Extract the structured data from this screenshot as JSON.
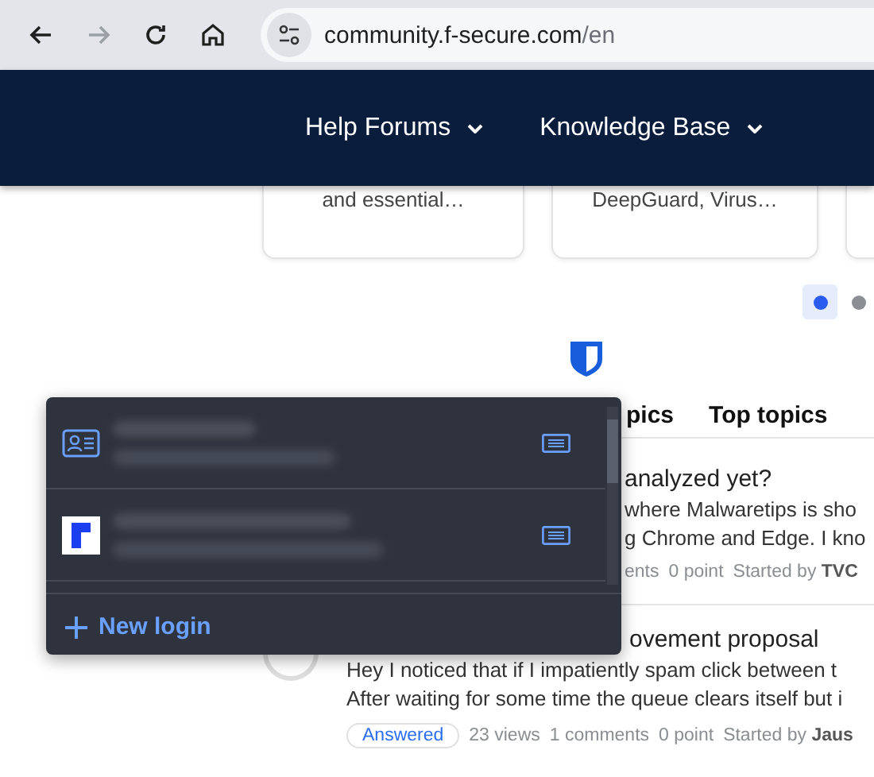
{
  "browser": {
    "url_host": "community.f-secure.com",
    "url_path": "/en",
    "forward_disabled": true
  },
  "nav": [
    {
      "label": "Help Forums"
    },
    {
      "label": "Knowledge Base"
    }
  ],
  "cards": [
    {
      "text": "and essential…"
    },
    {
      "text": "DeepGuard, Virus…"
    }
  ],
  "carousel_dots": [
    {
      "selected": true
    },
    {
      "selected": false
    }
  ],
  "tabs": [
    {
      "label": "pics"
    },
    {
      "label": "Top topics"
    }
  ],
  "topics": [
    {
      "title": "analyzed yet?",
      "lines": [
        "where Malwaretips is sho",
        "g Chrome and Edge. I kno"
      ],
      "meta": [
        "ents",
        "0 point"
      ],
      "started_by": "Started by",
      "author": "TVC"
    },
    {
      "title": "ovement proposal",
      "lines": [
        "Hey I noticed that if I impatiently spam click between t",
        "After waiting for some time the queue clears itself but i"
      ],
      "badge": "Answered",
      "meta": [
        "23 views",
        "1 comments",
        "0 point"
      ],
      "started_by": "Started by",
      "author": "Jaus"
    }
  ],
  "popup": {
    "items": [
      {
        "kind": "identity"
      },
      {
        "kind": "login"
      }
    ],
    "new_button": "New login"
  }
}
